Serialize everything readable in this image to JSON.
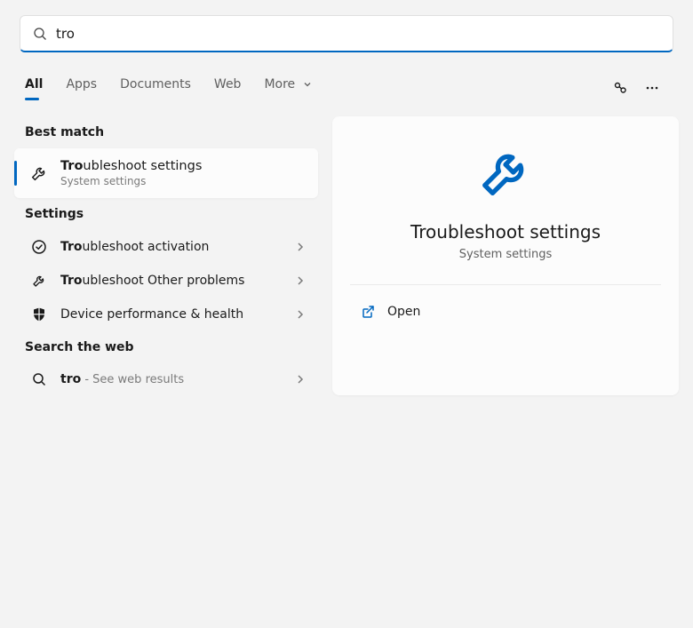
{
  "search": {
    "query": "tro"
  },
  "tabs": {
    "all": "All",
    "apps": "Apps",
    "documents": "Documents",
    "web": "Web",
    "more": "More"
  },
  "sections": {
    "best_match": "Best match",
    "settings": "Settings",
    "search_web": "Search the web"
  },
  "best_match": {
    "title_bold": "Tro",
    "title_rest": "ubleshoot settings",
    "subtitle": "System settings"
  },
  "settings_results": [
    {
      "bold": "Tro",
      "rest": "ubleshoot activation",
      "icon": "check-circle-icon"
    },
    {
      "bold": "Tro",
      "rest": "ubleshoot Other problems",
      "icon": "wrench-icon"
    },
    {
      "bold": "",
      "rest": "Device performance & health",
      "icon": "shield-icon"
    }
  ],
  "web_result": {
    "bold": "tro",
    "suffix": " - See web results"
  },
  "preview": {
    "title": "Troubleshoot settings",
    "subtitle": "System settings",
    "action_open": "Open"
  }
}
